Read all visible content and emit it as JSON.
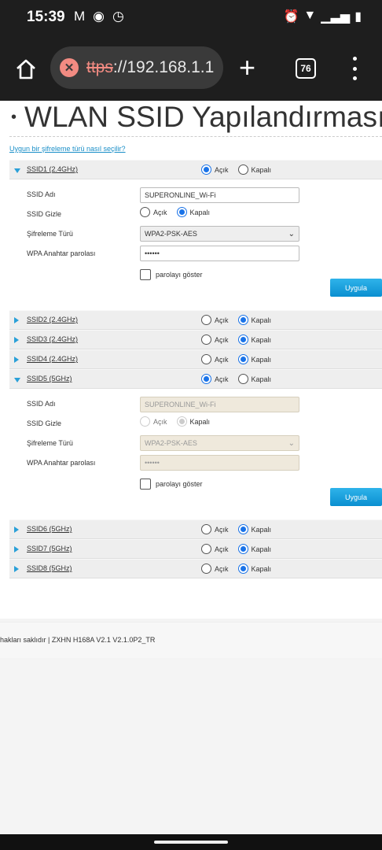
{
  "status_bar": {
    "time": "15:39",
    "battery_level": "low"
  },
  "browser": {
    "url_protocol": "ttps",
    "url_rest": "://192.168.1.1",
    "tab_count": "76"
  },
  "page": {
    "title": "WLAN SSID Yapılandırması",
    "help_link": "Uygun bir şifreleme türü nasıl seçilir?",
    "labels": {
      "on": "Açık",
      "off": "Kapalı",
      "ssid_name": "SSID Adı",
      "ssid_hidden": "SSID Gizle",
      "encryption": "Şifreleme Türü",
      "wpa_password": "WPA Anahtar parolası",
      "show_password": "parolayı göster",
      "apply": "Uygula"
    },
    "ssid_rows": [
      {
        "name": "SSID1 (2.4GHz)",
        "enabled": true,
        "expanded": true
      },
      {
        "name": "SSID2 (2.4GHz)",
        "enabled": false,
        "expanded": false
      },
      {
        "name": "SSID3 (2.4GHz)",
        "enabled": false,
        "expanded": false
      },
      {
        "name": "SSID4 (2.4GHz)",
        "enabled": false,
        "expanded": false
      },
      {
        "name": "SSID5 (5GHz)",
        "enabled": true,
        "expanded": true
      },
      {
        "name": "SSID6 (5GHz)",
        "enabled": false,
        "expanded": false
      },
      {
        "name": "SSID7 (5GHz)",
        "enabled": false,
        "expanded": false
      },
      {
        "name": "SSID8 (5GHz)",
        "enabled": false,
        "expanded": false
      }
    ],
    "ssid1_panel": {
      "ssid_name": "SUPERONLINE_Wi-Fi",
      "hidden": false,
      "encryption": "WPA2-PSK-AES",
      "password": "••••••"
    },
    "ssid5_panel": {
      "ssid_name": "SUPERONLINE_Wi-Fi",
      "hidden": false,
      "encryption": "WPA2-PSK-AES",
      "password": "••••••",
      "disabled": true
    },
    "footer": "hakları saklıdır  |  ZXHN H168A V2.1 V2.1.0P2_TR"
  },
  "colors": {
    "accent": "#1a73e8",
    "link": "#1a8fc8",
    "button": "#0a8fd0",
    "browser_bar": "#1e1e1e"
  }
}
